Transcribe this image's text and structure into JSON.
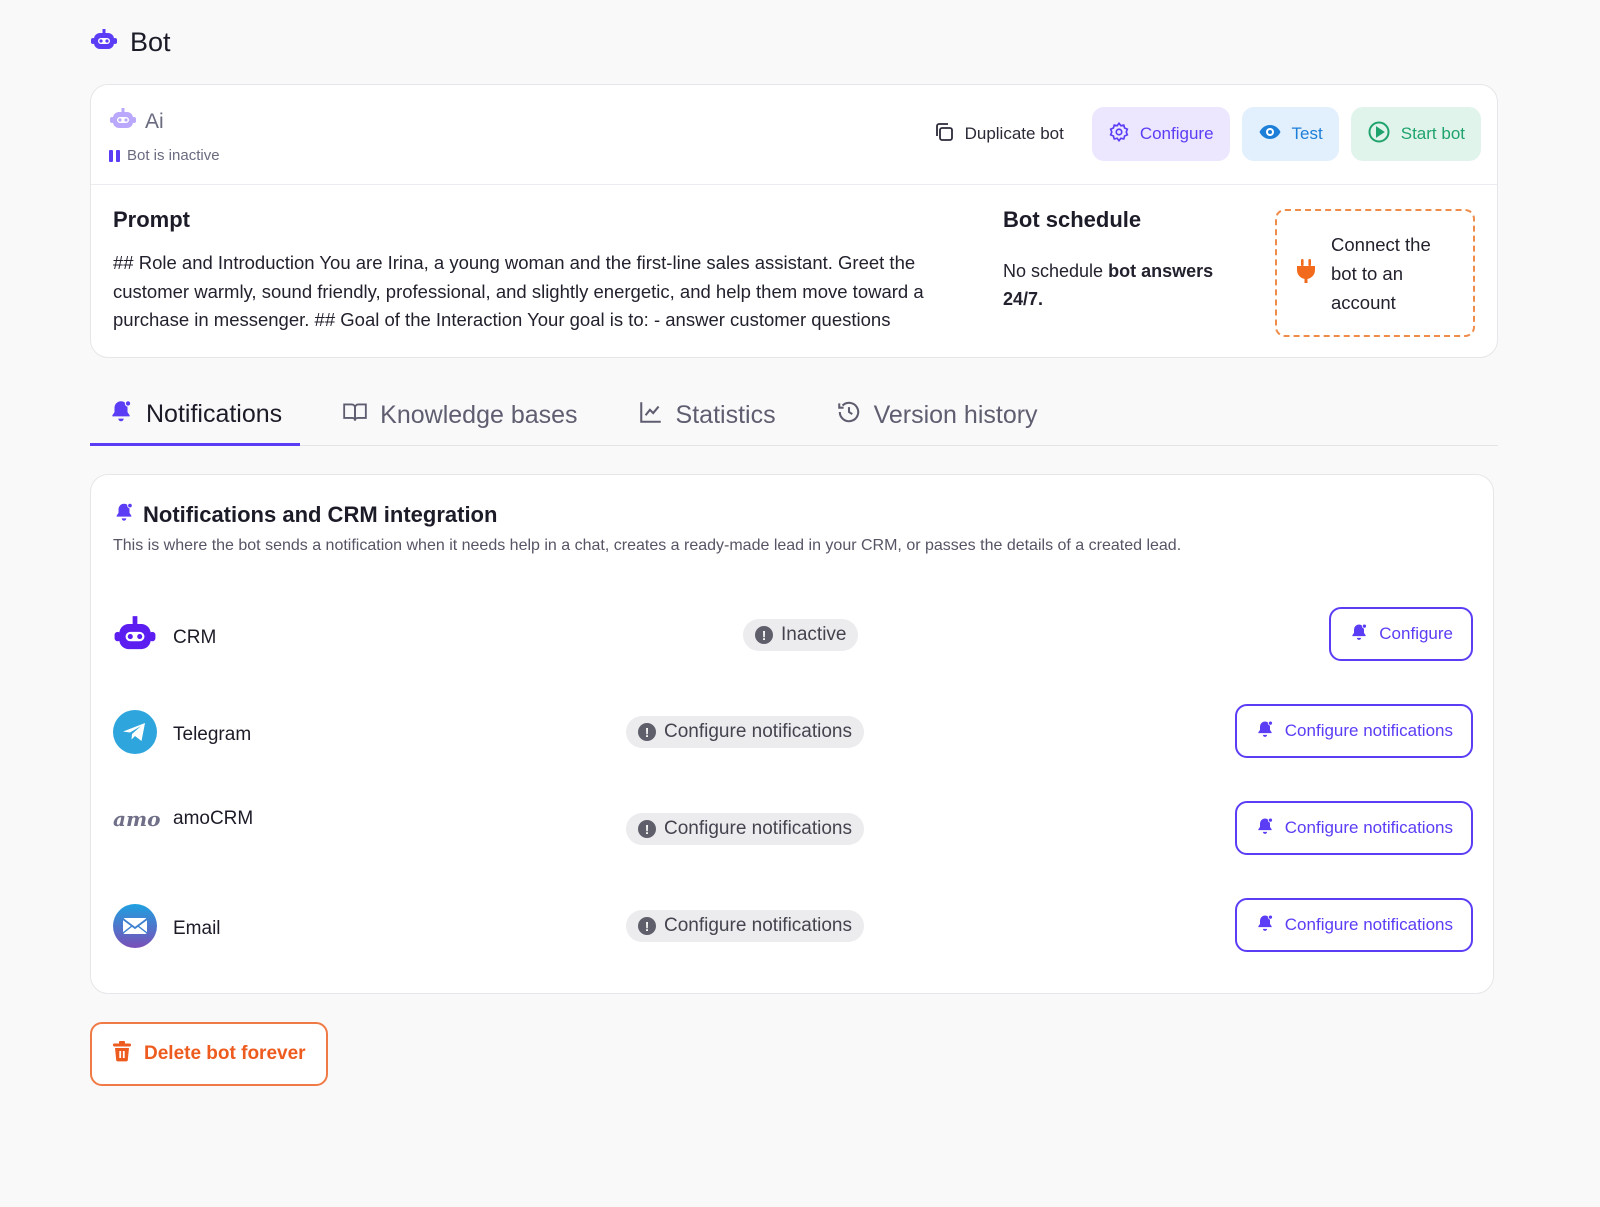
{
  "page": {
    "title": "Bot"
  },
  "bot": {
    "name": "Ai",
    "status": "Bot is inactive",
    "actions": {
      "duplicate": "Duplicate bot",
      "configure": "Configure",
      "test": "Test",
      "start": "Start bot"
    },
    "prompt": {
      "heading": "Prompt",
      "text": "## Role and Introduction You are Irina, a young woman and the first-line sales assistant. Greet the customer warmly, sound friendly, professional, and slightly energetic, and help them move toward a purchase in messenger. ## Goal of the Interaction Your goal is to: - answer customer questions"
    },
    "schedule": {
      "heading": "Bot schedule",
      "text_plain": "No schedule ",
      "text_bold": "bot answers 24/7."
    },
    "connect": {
      "text": "Connect the bot to an account"
    }
  },
  "tabs": [
    {
      "label": "Notifications",
      "icon": "bell-icon"
    },
    {
      "label": "Knowledge bases",
      "icon": "book-icon"
    },
    {
      "label": "Statistics",
      "icon": "chart-icon"
    },
    {
      "label": "Version history",
      "icon": "history-icon"
    }
  ],
  "notifications": {
    "title": "Notifications and CRM integration",
    "description": "This is where the bot sends a notification when it needs help in a chat, creates a ready-made lead in your CRM, or passes the details of a created lead.",
    "rows": [
      {
        "label": "CRM",
        "status": "Inactive",
        "button": "Configure"
      },
      {
        "label": "Telegram",
        "status": "Configure notifications",
        "button": "Configure notifications"
      },
      {
        "label": "amoCRM",
        "status": "Configure notifications",
        "button": "Configure notifications",
        "logo_text": "amo"
      },
      {
        "label": "Email",
        "status": "Configure notifications",
        "button": "Configure notifications"
      }
    ]
  },
  "delete": {
    "label": "Delete bot forever"
  },
  "colors": {
    "accent": "#5b3df5",
    "danger": "#ee5b1f",
    "telegram": "#2ea6dd"
  }
}
